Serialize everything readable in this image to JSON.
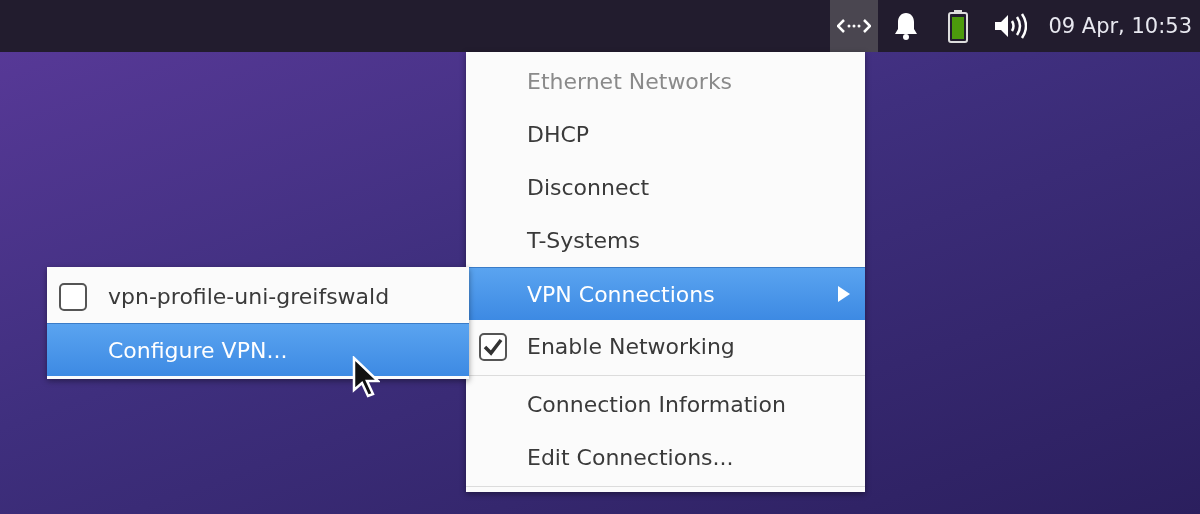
{
  "panel": {
    "tray": [
      {
        "kind": "network",
        "selected": true
      },
      {
        "kind": "bell",
        "selected": false
      },
      {
        "kind": "battery",
        "selected": false
      },
      {
        "kind": "volume",
        "selected": false
      }
    ],
    "clock": "09 Apr, 10:53"
  },
  "menu": {
    "items": [
      {
        "kind": "header",
        "label": "Ethernet Networks"
      },
      {
        "kind": "item",
        "label": "DHCP",
        "selected": false
      },
      {
        "kind": "item",
        "label": "Disconnect",
        "selected": false
      },
      {
        "kind": "item",
        "label": "T-Systems",
        "selected": false
      },
      {
        "kind": "submenu",
        "label": "VPN Connections",
        "selected": true
      },
      {
        "kind": "check",
        "label": "Enable Networking",
        "checked": true,
        "selected": false
      },
      {
        "kind": "separator"
      },
      {
        "kind": "item",
        "label": "Connection Information",
        "selected": false
      },
      {
        "kind": "item",
        "label": "Edit Connections...",
        "selected": false
      },
      {
        "kind": "separator"
      }
    ]
  },
  "submenu": {
    "items": [
      {
        "kind": "check",
        "label": "vpn-profile-uni-greifswald",
        "checked": false,
        "selected": false
      },
      {
        "kind": "item",
        "label": "Configure VPN...",
        "selected": true
      }
    ]
  }
}
